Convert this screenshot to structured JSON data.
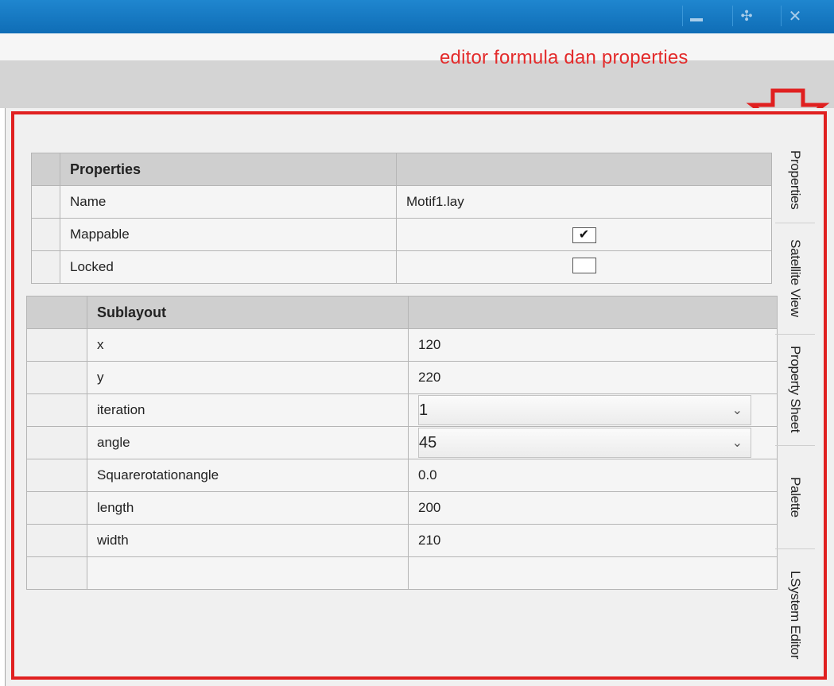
{
  "annotation": {
    "text": "editor formula dan properties",
    "color": "#e32b2b"
  },
  "window_controls": {
    "minimize_icon": "minimize-icon",
    "maximize_icon": "maximize-icon",
    "close_icon": "close-icon",
    "maximize_glyph": "✣",
    "close_glyph": "✕"
  },
  "properties_table": {
    "header": "Properties",
    "rows": [
      {
        "label": "Name",
        "value": "Motif1.lay"
      },
      {
        "label": "Mappable",
        "checked": true,
        "check_glyph": "✔"
      },
      {
        "label": "Locked",
        "checked": false,
        "check_glyph": ""
      }
    ]
  },
  "sublayout_table": {
    "header": "Sublayout",
    "rows": [
      {
        "label": "x",
        "value": "120"
      },
      {
        "label": "y",
        "value": "220"
      },
      {
        "label": "iteration",
        "value": "1",
        "type": "dropdown"
      },
      {
        "label": "angle",
        "value": "45",
        "type": "dropdown"
      },
      {
        "label": "Squarerotationangle",
        "value": "0.0"
      },
      {
        "label": "length",
        "value": "200"
      },
      {
        "label": "width",
        "value": "210"
      }
    ]
  },
  "side_tabs": [
    "Properties",
    "Satellite View",
    "Property Sheet",
    "Palette",
    "LSystem Editor"
  ],
  "chevron_glyph": "⌄",
  "colors": {
    "titlebar": "#1478c3",
    "annotation_red": "#e02020"
  }
}
